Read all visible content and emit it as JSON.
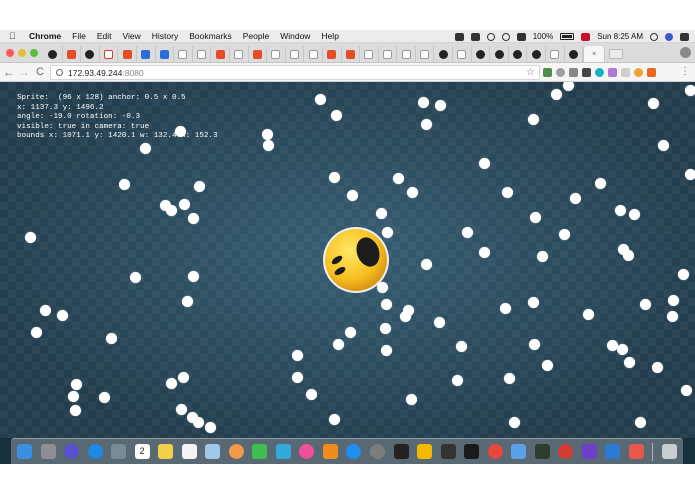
{
  "menubar": {
    "app_name": "Chrome",
    "items": [
      "File",
      "Edit",
      "View",
      "History",
      "Bookmarks",
      "People",
      "Window",
      "Help"
    ],
    "battery": "100%",
    "clock": "Sun 8:25 AM"
  },
  "tabs": {
    "favicons": [
      "github",
      "html5",
      "github",
      "gmail",
      "html5",
      "bitbucket",
      "bitbucket",
      "page",
      "page",
      "html5",
      "page",
      "html5",
      "page",
      "page",
      "page",
      "html5",
      "html5",
      "page",
      "page",
      "page",
      "page",
      "github",
      "page",
      "github",
      "github",
      "github",
      "github",
      "page",
      "github"
    ],
    "close_label": "×"
  },
  "toolbar": {
    "back_icon": "←",
    "forward_icon": "→",
    "reload_icon": "C",
    "url_host": "172.93.49.244",
    "url_port": ":8080",
    "star_icon": "☆",
    "menu_icon": "⋮"
  },
  "debug": {
    "line1": "Sprite:  (96 x 128) anchor: 0.5 x 0.5",
    "line2": "x: 1137.3 y: 1496.2",
    "line3": "angle: -19.0 rotation: -0.3",
    "line4": "visible: true in camera: true",
    "line5": "bounds x: 1071.1 y: 1420.1 w: 132.4 h: 152.3"
  },
  "colors": {
    "background": "#2b4e62",
    "dot": "#ffffff",
    "face_yellow": "#f6c021",
    "face_features": "#1c1c1c"
  },
  "dock": {
    "icons": [
      "finder",
      "launchpad",
      "siri",
      "safari",
      "photo-viewer",
      "calendar",
      "notes",
      "reminders",
      "preview",
      "photos",
      "facetime",
      "messages",
      "itunes",
      "books",
      "app-store",
      "system-preferences",
      "terminal",
      "sketch",
      "console",
      "terminal-2",
      "chrome",
      "mail",
      "activity-monitor",
      "netease-music",
      "github-desktop",
      "visual-studio-code",
      "photo-editor",
      "trash"
    ],
    "calendar_day": "2"
  }
}
